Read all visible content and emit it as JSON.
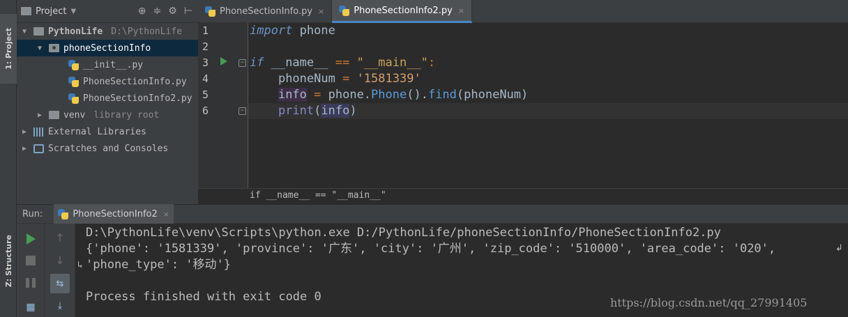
{
  "left_strip": {
    "project_tab": "1: Project",
    "structure_tab": "Z: Structure"
  },
  "project_panel": {
    "title": "Project",
    "tree": [
      {
        "label": "PythonLife",
        "hint": "D:\\PythonLife",
        "type": "folder",
        "expanded": true
      },
      {
        "label": "phoneSectionInfo",
        "type": "package",
        "expanded": true,
        "selected": true
      },
      {
        "label": "__init__.py",
        "type": "python-file"
      },
      {
        "label": "PhoneSectionInfo.py",
        "type": "python-file"
      },
      {
        "label": "PhoneSectionInfo2.py",
        "type": "python-file"
      },
      {
        "label": "venv",
        "hint": "library root",
        "type": "folder",
        "expanded": false
      },
      {
        "label": "External Libraries",
        "type": "libraries",
        "expanded": false
      },
      {
        "label": "Scratches and Consoles",
        "type": "scratches",
        "expanded": false
      }
    ]
  },
  "editor": {
    "tabs": [
      {
        "label": "PhoneSectionInfo.py",
        "close": "×",
        "active": false
      },
      {
        "label": "PhoneSectionInfo2.py",
        "close": "×",
        "active": true
      }
    ],
    "line_numbers": [
      "1",
      "2",
      "3",
      "4",
      "5",
      "6"
    ],
    "code": {
      "l1_kw": "import",
      "l1_mod": " phone",
      "l3_kw": "if",
      "l3_name": " __name__ ",
      "l3_op": "==",
      "l3_str": " \"__main__\"",
      "l3_colon": ":",
      "l4_indent": "    ",
      "l4_var": "phoneNum",
      "l4_op": " = ",
      "l4_str": "'1581339'",
      "l5_indent": "    ",
      "l5_var": "info",
      "l5_op": " = ",
      "l5_obj": "phone.",
      "l5_cls": "Phone",
      "l5_paren": "().",
      "l5_fn": "find",
      "l5_arg": "(phoneNum)",
      "l6_indent": "    ",
      "l6_builtin": "print",
      "l6_open": "(",
      "l6_arg": "info",
      "l6_close": ")"
    },
    "breadcrumb": "if __name__ == \"__main__\""
  },
  "run_panel": {
    "label": "Run:",
    "tab_label": "PhoneSectionInfo2",
    "tab_close": "×",
    "console_lines": [
      "D:\\PythonLife\\venv\\Scripts\\python.exe D:/PythonLife/phoneSectionInfo/PhoneSectionInfo2.py",
      "{'phone': '1581339', 'province': '广东', 'city': '广州', 'zip_code': '510000', 'area_code': '020',",
      "'phone_type': '移动'}",
      "",
      "Process finished with exit code 0"
    ],
    "wrap_glyph_end": "↲",
    "wrap_glyph_start": "↳",
    "watermark": "https://blog.csdn.net/qq_27991405"
  },
  "colors": {
    "accent": "#4a88c7",
    "run_green": "#499c54",
    "selection": "#0d293e"
  }
}
